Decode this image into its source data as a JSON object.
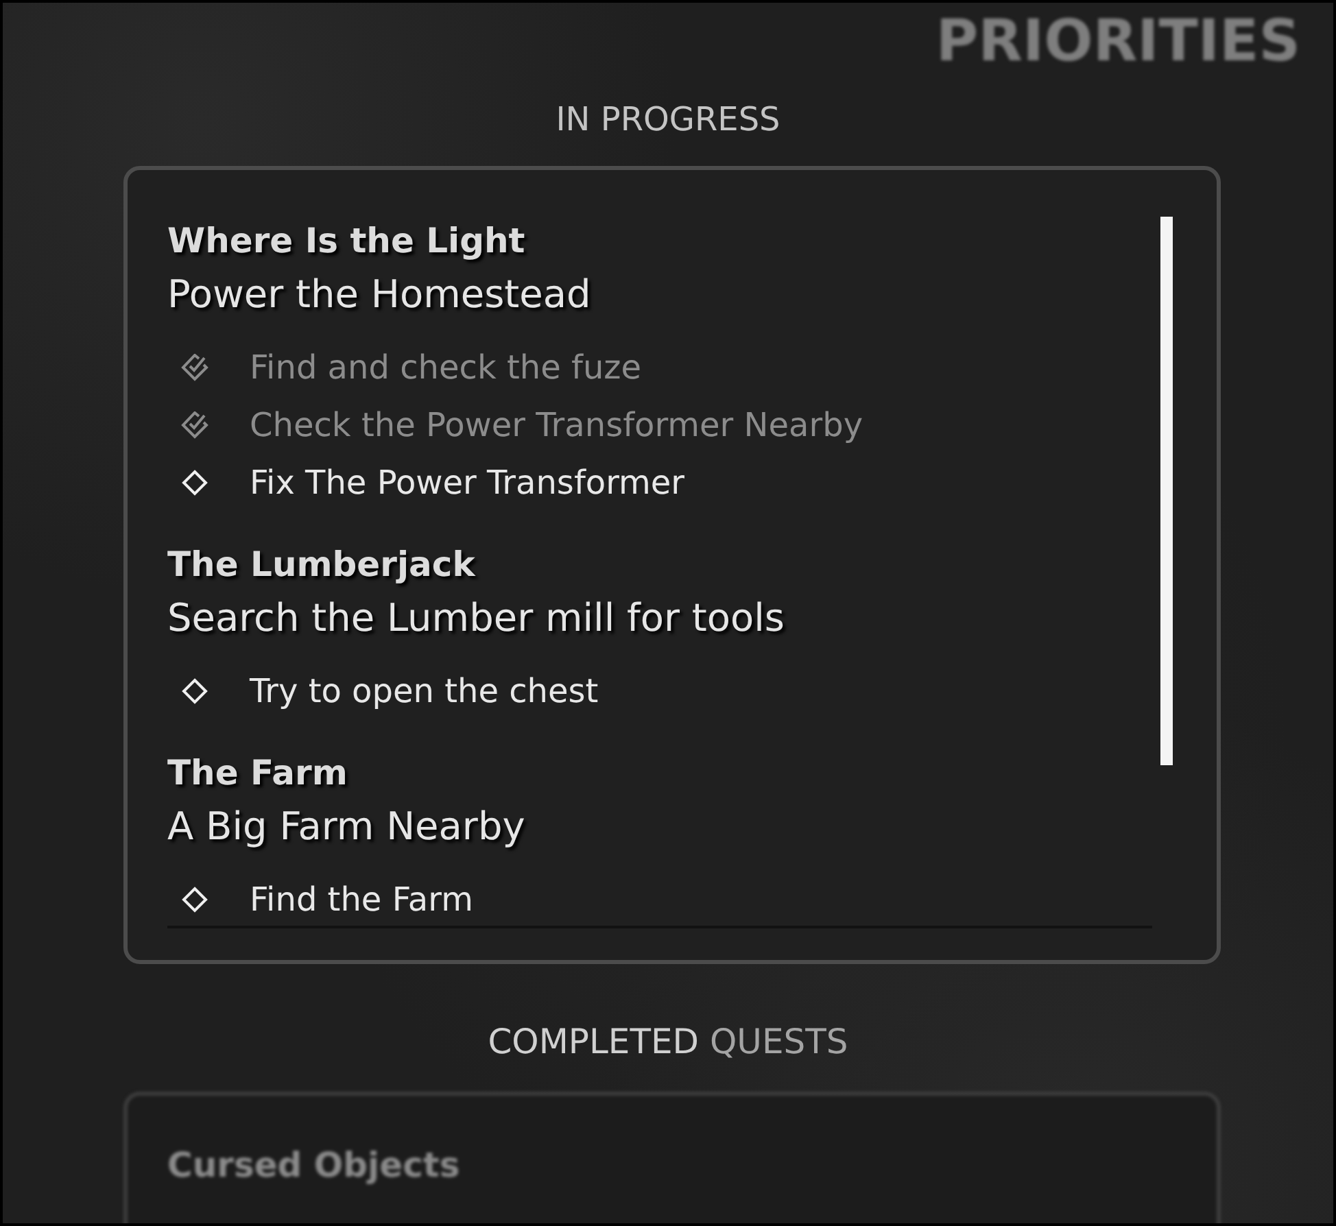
{
  "header": {
    "title": "PRIORITIES"
  },
  "in_progress": {
    "heading": "IN PROGRESS",
    "quests": [
      {
        "title": "Where Is the Light",
        "subtitle": "Power the Homestead",
        "objectives": [
          {
            "text": "Find and check the fuze",
            "done": true
          },
          {
            "text": "Check the Power Transformer Nearby",
            "done": true
          },
          {
            "text": "Fix The Power Transformer",
            "done": false
          }
        ]
      },
      {
        "title": "The Lumberjack",
        "subtitle": "Search the Lumber mill for tools",
        "objectives": [
          {
            "text": "Try to open the chest",
            "done": false
          }
        ]
      },
      {
        "title": "The Farm",
        "subtitle": "A Big Farm Nearby",
        "objectives": [
          {
            "text": "Find the Farm",
            "done": false
          }
        ]
      }
    ]
  },
  "completed": {
    "heading": [
      {
        "text": "COMPLETED",
        "dim": false
      },
      {
        "text": "QUESTS",
        "dim": true
      }
    ],
    "quests": [
      {
        "title": "Cursed Objects"
      }
    ]
  }
}
